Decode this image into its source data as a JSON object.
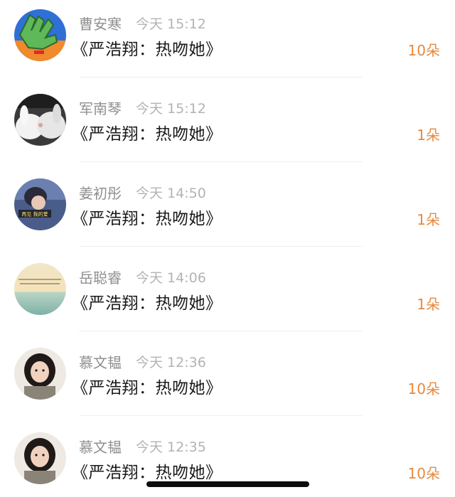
{
  "items": [
    {
      "name": "曹安寒",
      "time": "今天 15:12",
      "message": "《严浩翔：热吻她》",
      "count": "10朵",
      "avatar": "green-hand-avatar"
    },
    {
      "name": "军南琴",
      "time": "今天 15:12",
      "message": "《严浩翔：热吻她》",
      "count": "1朵",
      "avatar": "kissing-bunnies-avatar"
    },
    {
      "name": "姜初彤",
      "time": "今天 14:50",
      "message": "《严浩翔：热吻她》",
      "count": "1朵",
      "avatar": "photo-with-caption-avatar",
      "avatar_caption": "再见 我的爱"
    },
    {
      "name": "岳聪睿",
      "time": "今天 14:06",
      "message": "《严浩翔：热吻她》",
      "count": "1朵",
      "avatar": "sea-landscape-avatar"
    },
    {
      "name": "慕文韫",
      "time": "今天 12:36",
      "message": "《严浩翔：热吻她》",
      "count": "10朵",
      "avatar": "girl-portrait-avatar"
    },
    {
      "name": "慕文韫",
      "time": "今天 12:35",
      "message": "《严浩翔：热吻她》",
      "count": "10朵",
      "avatar": "girl-portrait-avatar"
    }
  ],
  "colors": {
    "name": "#8f8f8f",
    "time": "#b3b3b3",
    "message": "#1a1a1a",
    "count": "#e8893c"
  }
}
